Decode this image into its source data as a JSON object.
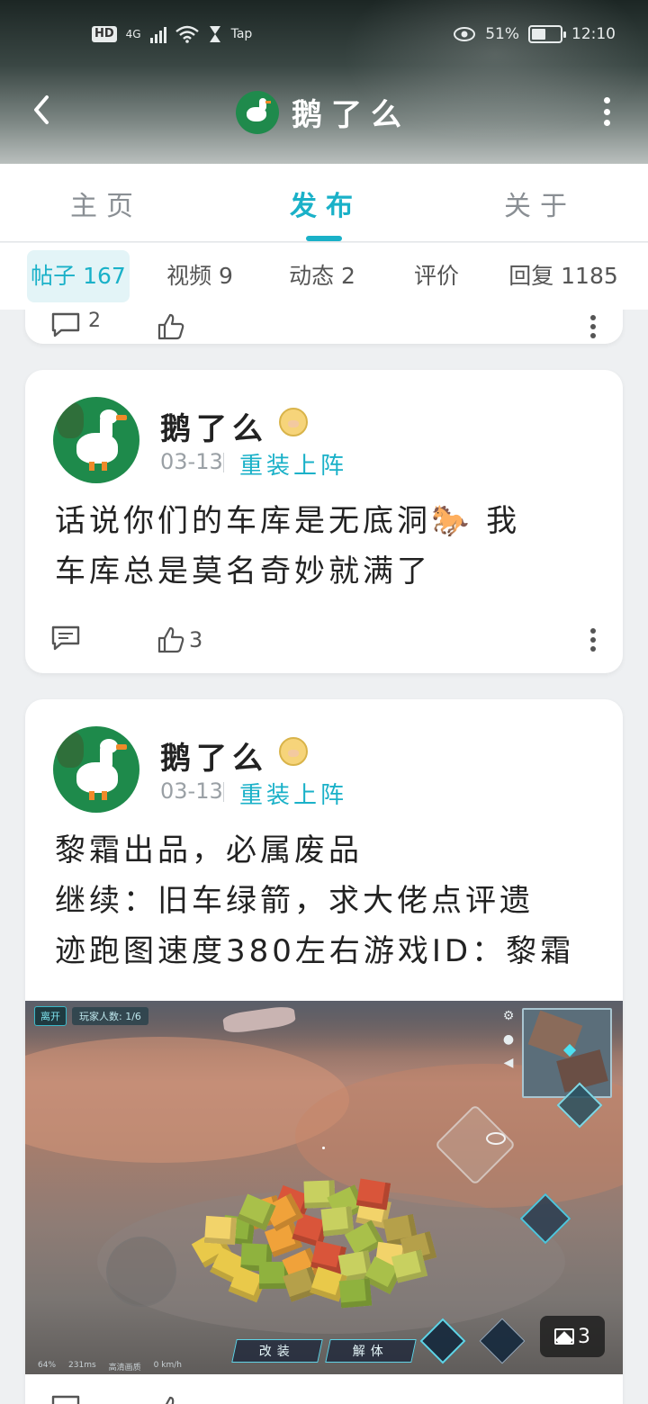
{
  "status_bar": {
    "network": "4G",
    "hd": "HD",
    "app_label": "Tap",
    "battery": "51%",
    "battery_level": 0.51,
    "time": "12:10"
  },
  "header": {
    "title": "鹅了么"
  },
  "main_tabs": [
    {
      "label": "主页",
      "active": false
    },
    {
      "label": "发布",
      "active": true
    },
    {
      "label": "关于",
      "active": false
    }
  ],
  "sub_tabs": [
    {
      "label": "帖子 167",
      "active": true
    },
    {
      "label": "视频 9",
      "active": false
    },
    {
      "label": "动态 2",
      "active": false
    },
    {
      "label": "评价",
      "active": false
    },
    {
      "label": "回复 1185",
      "active": false
    }
  ],
  "prev_card": {
    "comment_count": "2"
  },
  "posts": [
    {
      "author": "鹅了么",
      "date": "03-13",
      "game": "重装上阵",
      "text_lines": [
        "话说你们的车库是无底洞🐎 我",
        "车库总是莫名奇妙就满了"
      ],
      "comment_count": "",
      "like_count": "3"
    },
    {
      "author": "鹅了么",
      "date": "03-13",
      "game": "重装上阵",
      "text_lines": [
        "黎霜出品，必属废品",
        "继续：旧车绿箭，求大佬点评遗",
        "迹跑图速度380左右游戏ID：黎霜"
      ],
      "image": {
        "leave_label": "离开",
        "players_label": "玩家人数: 1/6",
        "button_modify": "改装",
        "button_disassemble": "解体",
        "status_battery": "64%",
        "status_ping": "231ms",
        "status_quality": "高清画质",
        "status_speed": "0 km/h",
        "image_count": "3"
      }
    }
  ],
  "icons": {
    "back": "chevron-left-icon",
    "more": "more-vertical-icon",
    "comment": "comment-icon",
    "like": "thumbs-up-icon",
    "image": "image-icon"
  },
  "colors": {
    "accent": "#1ab1c8",
    "avatar_green": "#1e8a4b"
  }
}
